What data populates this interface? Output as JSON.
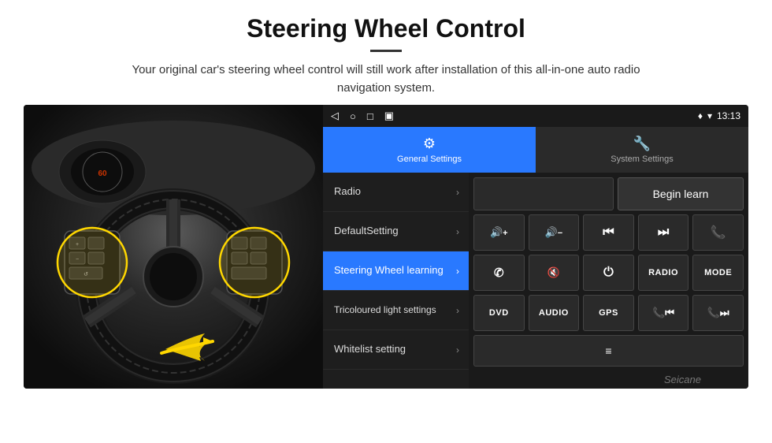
{
  "header": {
    "title": "Steering Wheel Control",
    "divider": true,
    "subtitle": "Your original car's steering wheel control will still work after installation of this all-in-one auto radio navigation system."
  },
  "android_ui": {
    "status_bar": {
      "time": "13:13",
      "icons": [
        "◁",
        "○",
        "□",
        "▣"
      ],
      "right_icons": [
        "♥",
        "▾"
      ]
    },
    "tabs": [
      {
        "label": "General Settings",
        "icon": "⚙",
        "active": true
      },
      {
        "label": "System Settings",
        "icon": "🌐",
        "active": false
      }
    ],
    "menu_items": [
      {
        "label": "Radio",
        "active": false
      },
      {
        "label": "DefaultSetting",
        "active": false
      },
      {
        "label": "Steering Wheel learning",
        "active": true
      },
      {
        "label": "Tricoloured light settings",
        "active": false
      },
      {
        "label": "Whitelist setting",
        "active": false
      }
    ],
    "controls": {
      "begin_learn_label": "Begin learn",
      "row1": [
        "🔊+",
        "🔊−",
        "⏮",
        "⏭",
        "📞"
      ],
      "row1_symbols": [
        "",
        "",
        "",
        "",
        ""
      ],
      "row2": [
        "✆",
        "🔇×",
        "⏻",
        "RADIO",
        "MODE"
      ],
      "row3": [
        "DVD",
        "AUDIO",
        "GPS",
        "",
        ""
      ],
      "row3_last": [
        "",
        ""
      ]
    }
  },
  "watermark": "Seicane"
}
